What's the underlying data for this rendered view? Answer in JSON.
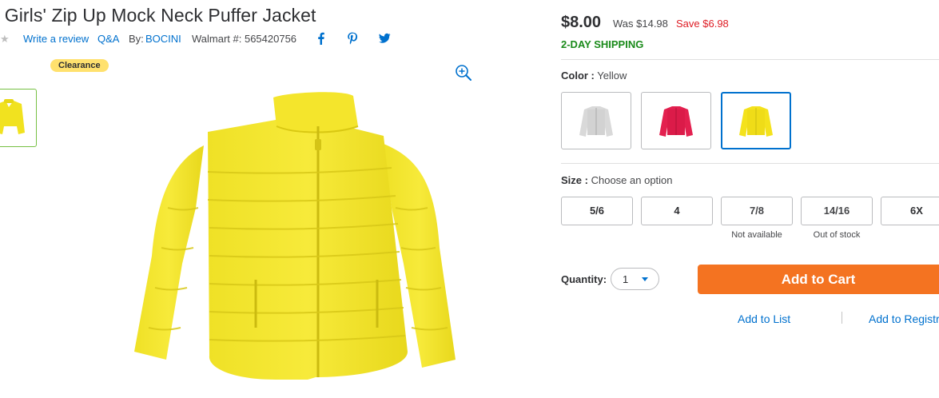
{
  "product": {
    "title": "i Girls' Zip Up Mock Neck Puffer Jacket",
    "rating_star": "★",
    "write_review": "Write a review",
    "qa": "Q&A",
    "by_label": "By:",
    "brand": "BOCINI",
    "walmart_number": "Walmart #: 565420756",
    "social": [
      "facebook-icon",
      "pinterest-icon",
      "twitter-icon"
    ],
    "badge": "Clearance"
  },
  "pricing": {
    "price": "$8.00",
    "was": "Was $14.98",
    "save": "Save $6.98",
    "shipping": "2-DAY SHIPPING"
  },
  "color": {
    "label": "Color :",
    "selected": "Yellow",
    "options": [
      {
        "name": "gray",
        "hex": "#d8d8d8"
      },
      {
        "name": "pink",
        "hex": "#e3204f"
      },
      {
        "name": "yellow",
        "hex": "#f4e21c"
      }
    ]
  },
  "size": {
    "label": "Size :",
    "prompt": "Choose an option",
    "options": [
      {
        "label": "5/6",
        "note": ""
      },
      {
        "label": "4",
        "note": ""
      },
      {
        "label": "7/8",
        "note": "Not available"
      },
      {
        "label": "14/16",
        "note": "Out of stock"
      },
      {
        "label": "6X",
        "note": ""
      }
    ]
  },
  "quantity": {
    "label": "Quantity:",
    "value": "1"
  },
  "actions": {
    "add_to_cart": "Add to Cart",
    "add_to_list": "Add to List",
    "add_to_registry": "Add to Registry"
  },
  "colors": {
    "link": "#0071ce",
    "price_save": "#de1c24",
    "shipping": "#1a8a1a",
    "cart_button": "#f47321",
    "badge": "#ffe16e",
    "thumb_border": "#76c043"
  }
}
